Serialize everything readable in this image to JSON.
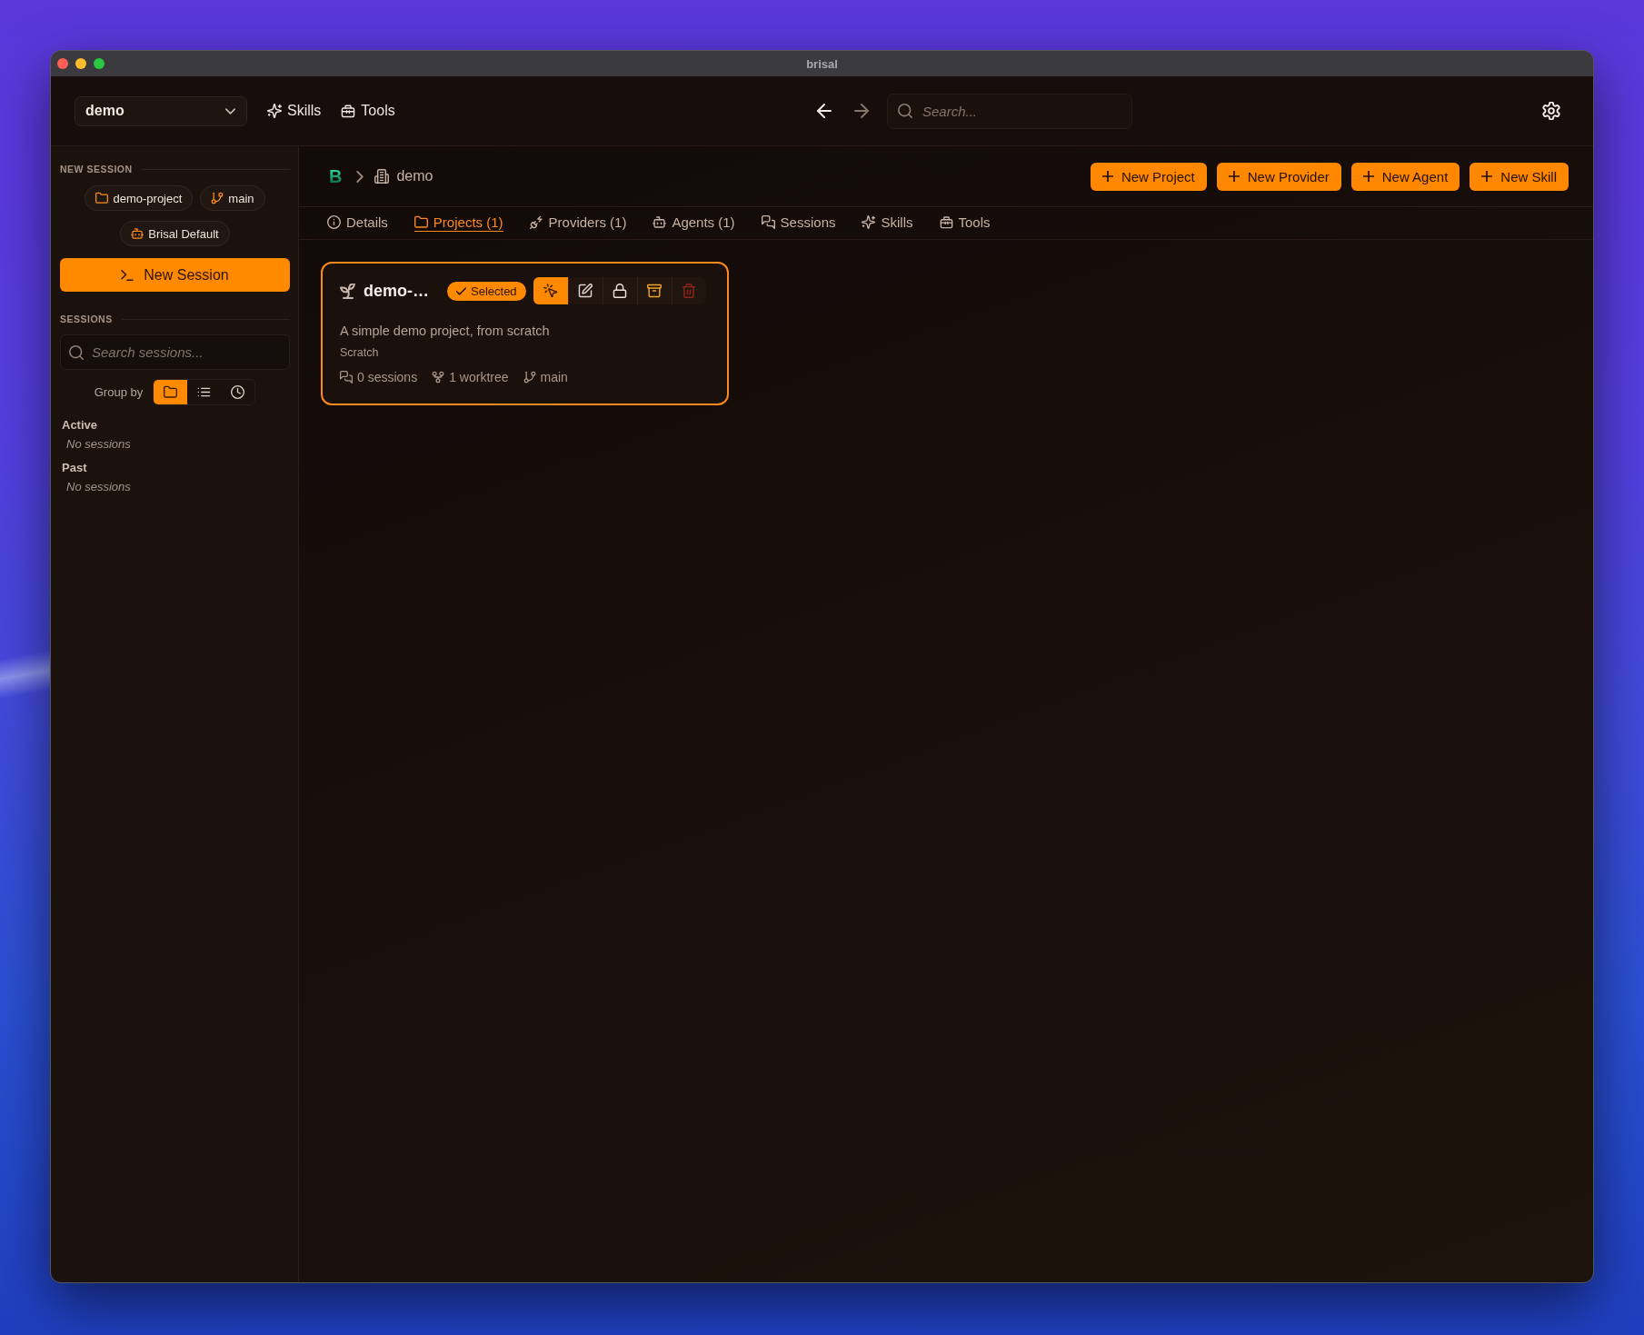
{
  "window": {
    "title": "brisal"
  },
  "topbar": {
    "project_selector": {
      "value": "demo"
    },
    "links": [
      {
        "kind": "skills",
        "label": "Skills"
      },
      {
        "kind": "tools",
        "label": "Tools"
      }
    ],
    "nav_buttons": [
      {
        "kind": "back",
        "disabled": false
      },
      {
        "kind": "forward",
        "disabled": true
      }
    ],
    "search": {
      "placeholder": "Search..."
    }
  },
  "sidebar": {
    "new_session": {
      "heading": "NEW SESSION",
      "chips": [
        {
          "kind": "folder",
          "label": "demo-project"
        },
        {
          "kind": "branch",
          "label": "main"
        },
        {
          "kind": "agent",
          "label": "Brisal Default"
        }
      ],
      "button": "New Session"
    },
    "sessions": {
      "heading": "SESSIONS",
      "search": {
        "placeholder": "Search sessions..."
      },
      "group_by": {
        "label": "Group by",
        "options": [
          {
            "kind": "folder",
            "selected": true
          },
          {
            "kind": "list",
            "selected": false
          },
          {
            "kind": "time",
            "selected": false
          }
        ]
      },
      "groups": [
        {
          "title": "Active",
          "empty_text": "No sessions"
        },
        {
          "title": "Past",
          "empty_text": "No sessions"
        }
      ]
    }
  },
  "main": {
    "breadcrumb": {
      "logo": "B",
      "items": [
        {
          "kind": "workspace",
          "label": "demo"
        }
      ]
    },
    "actions": [
      "New Project",
      "New Provider",
      "New Agent",
      "New Skill"
    ],
    "tabs": [
      {
        "kind": "info",
        "label": "Details",
        "selected": false
      },
      {
        "kind": "folder",
        "label": "Projects (1)",
        "selected": true
      },
      {
        "kind": "providers",
        "label": "Providers (1)",
        "selected": false
      },
      {
        "kind": "agents",
        "label": "Agents (1)",
        "selected": false
      },
      {
        "kind": "sessions",
        "label": "Sessions",
        "selected": false
      },
      {
        "kind": "skills",
        "label": "Skills",
        "selected": false
      },
      {
        "kind": "tools",
        "label": "Tools",
        "selected": false
      }
    ],
    "projects": [
      {
        "name": "demo-…",
        "selected": true,
        "badge": "Selected",
        "actions": [
          {
            "kind": "select",
            "active": true
          },
          {
            "kind": "edit",
            "active": false
          },
          {
            "kind": "lock",
            "active": false
          },
          {
            "kind": "archive",
            "active": false
          },
          {
            "kind": "delete",
            "active": false
          }
        ],
        "description": "A simple demo project, from scratch",
        "template": "Scratch",
        "stats": [
          {
            "kind": "sessions",
            "label": "0 sessions"
          },
          {
            "kind": "worktree",
            "label": "1 worktree"
          },
          {
            "kind": "branch",
            "label": "main"
          }
        ]
      }
    ]
  }
}
